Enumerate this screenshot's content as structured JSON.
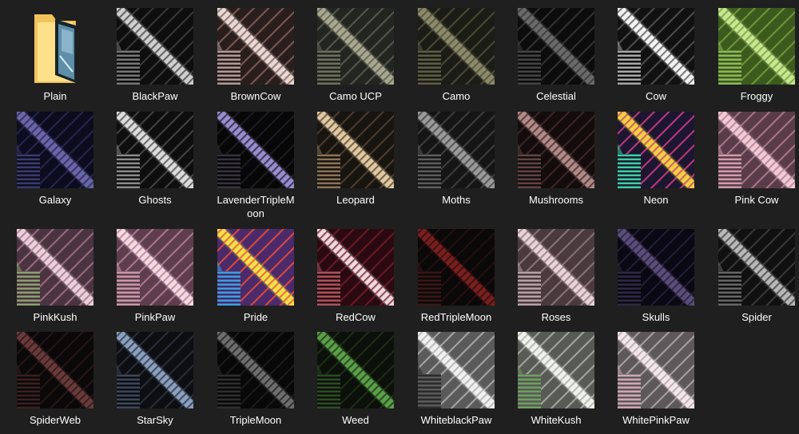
{
  "folder": {
    "label": "Plain",
    "icon": "folder-icon"
  },
  "items": [
    {
      "label": "BlackPaw",
      "bg": "#0e0e0e",
      "stripe": "#3a3a3a",
      "band": "#cfcfcf",
      "accent": "#777777"
    },
    {
      "label": "BrownCow",
      "bg": "#2a1e1c",
      "stripe": "#7a5a56",
      "band": "#e8d8d4",
      "accent": "#b09a96"
    },
    {
      "label": "Camo UCP",
      "bg": "#232520",
      "stripe": "#55584c",
      "band": "#a8a890",
      "accent": "#6e705f"
    },
    {
      "label": "Camo",
      "bg": "#1b1c15",
      "stripe": "#4a4a37",
      "band": "#8c8a6a",
      "accent": "#5e5d45"
    },
    {
      "label": "Celestial",
      "bg": "#0c0c0c",
      "stripe": "#333333",
      "band": "#6a6a6a",
      "accent": "#444444"
    },
    {
      "label": "Cow",
      "bg": "#111111",
      "stripe": "#4e4e4e",
      "band": "#f2f2f2",
      "accent": "#a8a8a8"
    },
    {
      "label": "Froggy",
      "bg": "#3c5a1e",
      "stripe": "#6f9a3a",
      "band": "#c8e690",
      "accent": "#8fb85a"
    },
    {
      "label": "Galaxy",
      "bg": "#0c0c1e",
      "stripe": "#262650",
      "band": "#6a66a8",
      "accent": "#3a3a6a"
    },
    {
      "label": "Ghosts",
      "bg": "#0e0e0e",
      "stripe": "#444444",
      "band": "#dcdcdc",
      "accent": "#8a8a8a"
    },
    {
      "label": "LavenderTripleMoon",
      "bg": "#070707",
      "stripe": "#1c1c22",
      "band": "#9a8cd0",
      "accent": "#36323e"
    },
    {
      "label": "Leopard",
      "bg": "#181410",
      "stripe": "#4c3e30",
      "band": "#e0c8a0",
      "accent": "#8a7356"
    },
    {
      "label": "Moths",
      "bg": "#151515",
      "stripe": "#3e3e3e",
      "band": "#9a9a9a",
      "accent": "#5c5c5c"
    },
    {
      "label": "Mushrooms",
      "bg": "#140c0c",
      "stripe": "#3e2626",
      "band": "#b08a88",
      "accent": "#5e4444"
    },
    {
      "label": "Neon",
      "bg": "#1c1630",
      "stripe": "#c03b7a",
      "band": "#f4d040",
      "accent": "#3ad0a0"
    },
    {
      "label": "Pink Cow",
      "bg": "#5a3c48",
      "stripe": "#a8788a",
      "band": "#f2cad6",
      "accent": "#cf9cac"
    },
    {
      "label": "PinkKush",
      "bg": "#4a3440",
      "stripe": "#9c6c82",
      "band": "#ead0da",
      "accent": "#8aa070"
    },
    {
      "label": "PinkPaw",
      "bg": "#5e3e4c",
      "stripe": "#aa7a8e",
      "band": "#f6d8e2",
      "accent": "#c898a8"
    },
    {
      "label": "Pride",
      "bg": "#4a2a6a",
      "stripe": "#e04a3a",
      "band": "#f6e04a",
      "accent": "#3aa0e0"
    },
    {
      "label": "RedCow",
      "bg": "#2a0a10",
      "stripe": "#6a1a26",
      "band": "#f0d8dc",
      "accent": "#a85460"
    },
    {
      "label": "RedTripleMoon",
      "bg": "#0a0808",
      "stripe": "#241010",
      "band": "#7a1e1e",
      "accent": "#3a1616"
    },
    {
      "label": "Roses",
      "bg": "#4a3a3e",
      "stripe": "#8a7478",
      "band": "#e8d4d8",
      "accent": "#b8a2a6"
    },
    {
      "label": "Skulls",
      "bg": "#0a0812",
      "stripe": "#241e38",
      "band": "#5a4e7a",
      "accent": "#2e2842"
    },
    {
      "label": "Spider",
      "bg": "#101010",
      "stripe": "#3a3a3a",
      "band": "#b8b8b8",
      "accent": "#666666"
    },
    {
      "label": "SpiderWeb",
      "bg": "#0a0808",
      "stripe": "#261616",
      "band": "#6a3a3a",
      "accent": "#3a2020"
    },
    {
      "label": "StarSky",
      "bg": "#0c0e12",
      "stripe": "#2a2e38",
      "band": "#8aa0c0",
      "accent": "#3e4658"
    },
    {
      "label": "TripleMoon",
      "bg": "#080808",
      "stripe": "#1c1c1c",
      "band": "#6e6e6e",
      "accent": "#2e2e2e"
    },
    {
      "label": "Weed",
      "bg": "#0c100a",
      "stripe": "#1e2e18",
      "band": "#5aa048",
      "accent": "#2e4a26"
    },
    {
      "label": "WhiteblackPaw",
      "bg": "#5a5a5a",
      "stripe": "#a8a8a8",
      "band": "#f0f0f0",
      "accent": "#2a2a2a"
    },
    {
      "label": "WhiteKush",
      "bg": "#585a56",
      "stripe": "#a4a8a0",
      "band": "#eef2ea",
      "accent": "#6ea060"
    },
    {
      "label": "WhitePinkPaw",
      "bg": "#5e585a",
      "stripe": "#aaa2a6",
      "band": "#f4e6ea",
      "accent": "#d0a8b4"
    }
  ]
}
